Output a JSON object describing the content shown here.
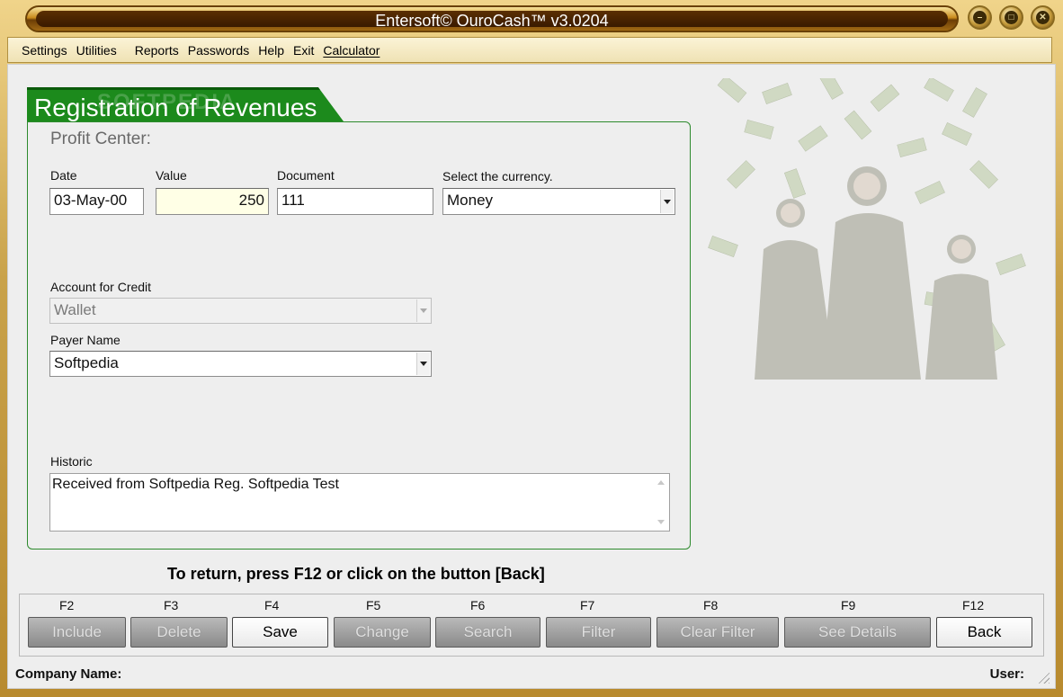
{
  "window": {
    "title": "Entersoft© OuroCash™ v3.0204",
    "controls": [
      "minimize-icon",
      "restore-icon",
      "close-icon"
    ]
  },
  "menu": {
    "items": [
      "Settings",
      "Utilities",
      "Reports",
      "Passwords",
      "Help",
      "Exit",
      "Calculator"
    ]
  },
  "form": {
    "title": "Registration of Revenues",
    "watermark": "SOFTPEDIA",
    "profit_center_label": "Profit Center:",
    "date_label": "Date",
    "date_value": "03-May-00",
    "value_label": "Value",
    "value_value": "250",
    "document_label": "Document",
    "document_value": "111",
    "currency_label": "Select the currency.",
    "currency_value": "Money",
    "account_label": "Account for Credit",
    "account_value": "Wallet",
    "payer_label": "Payer Name",
    "payer_value": "Softpedia",
    "historic_label": "Historic",
    "historic_value": "Received from Softpedia Reg. Softpedia Test"
  },
  "hint": "To return, press F12 or click on the button [Back]",
  "fkeys": {
    "include": {
      "key": "F2",
      "label": "Include"
    },
    "delete": {
      "key": "F3",
      "label": "Delete"
    },
    "save": {
      "key": "F4",
      "label": "Save"
    },
    "change": {
      "key": "F5",
      "label": "Change"
    },
    "search": {
      "key": "F6",
      "label": "Search"
    },
    "filter": {
      "key": "F7",
      "label": "Filter"
    },
    "clear_filter": {
      "key": "F8",
      "label": "Clear Filter"
    },
    "see_details": {
      "key": "F9",
      "label": "See Details"
    },
    "back": {
      "key": "F12",
      "label": "Back"
    }
  },
  "status": {
    "company_label": "Company Name:",
    "user_label": "User:"
  },
  "colors": {
    "header_green": "#1c8a1c",
    "frame_gold": "#c9a24a",
    "value_field": "#ffffe6"
  }
}
